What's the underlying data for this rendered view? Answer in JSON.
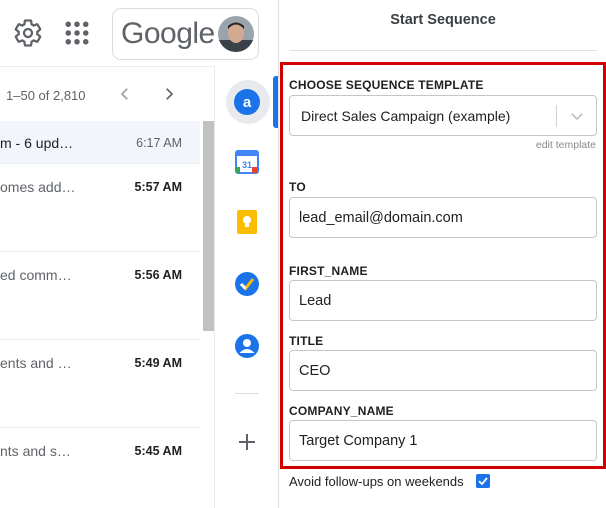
{
  "topbar": {
    "settings_icon": "gear-icon",
    "apps_icon": "apps-grid-icon",
    "logo_text": "Google",
    "avatar_icon": "user-avatar"
  },
  "mail_toolbar": {
    "pager_text": "1–50 of 2,810",
    "prev_icon": "chevron-left-icon",
    "next_icon": "chevron-right-icon"
  },
  "mail_rows": [
    {
      "subject": "m - 6 upd…",
      "time": "6:17 AM",
      "state": "read"
    },
    {
      "subject": "omes add…",
      "time": "5:57 AM",
      "state": "unread"
    },
    {
      "subject": "ed comm…",
      "time": "5:56 AM",
      "state": "unread"
    },
    {
      "subject": "ents and …",
      "time": "5:49 AM",
      "state": "unread"
    },
    {
      "subject": "nts and s…",
      "time": "5:45 AM",
      "state": "unread"
    }
  ],
  "side_icons": [
    "sequence-app-icon",
    "calendar-icon",
    "keep-icon",
    "tasks-icon",
    "contacts-icon",
    "add-icon"
  ],
  "calendar_day": "31",
  "panel": {
    "title": "Start Sequence",
    "template_label": "CHOOSE SEQUENCE TEMPLATE",
    "template_value": "Direct Sales Campaign (example)",
    "edit_template": "edit template",
    "fields": [
      {
        "label": "TO",
        "value": "lead_email@domain.com"
      },
      {
        "label": "FIRST_NAME",
        "value": "Lead"
      },
      {
        "label": "TITLE",
        "value": "CEO"
      },
      {
        "label": "COMPANY_NAME",
        "value": "Target Company 1"
      }
    ],
    "weekends_label": "Avoid follow-ups on weekends",
    "weekends_checked": true
  },
  "colors": {
    "accent": "#1a73e8",
    "highlight": "#d00000"
  }
}
